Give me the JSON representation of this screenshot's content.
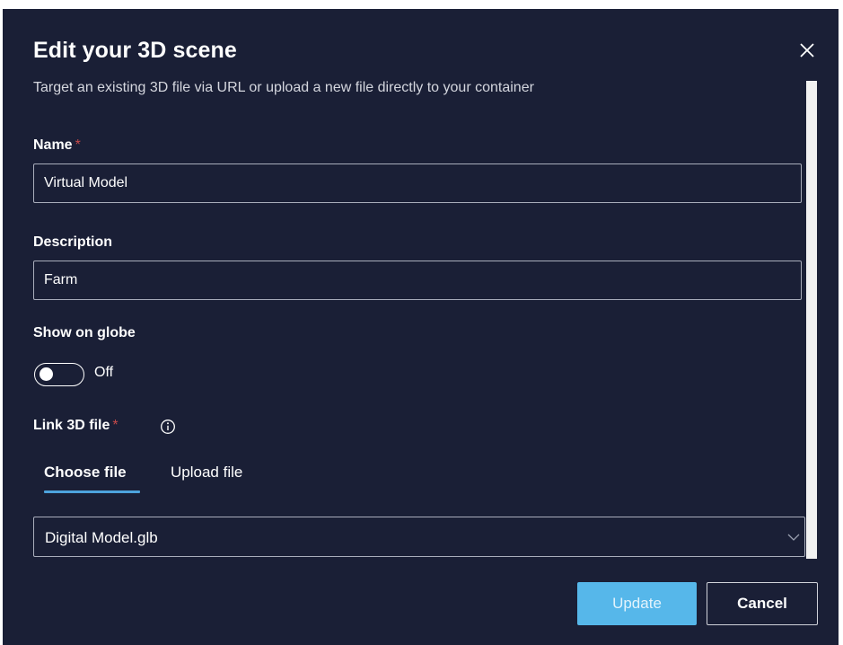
{
  "dialog": {
    "title": "Edit your 3D scene",
    "subtitle": "Target an existing 3D file via URL or upload a new file directly to your container",
    "close_icon": "close-icon"
  },
  "form": {
    "name": {
      "label": "Name",
      "required_mark": "*",
      "value": "Virtual Model"
    },
    "description": {
      "label": "Description",
      "value": "Farm"
    },
    "show_on_globe": {
      "label": "Show on globe",
      "state_text": "Off",
      "checked": false
    },
    "link_file": {
      "label": "Link 3D file",
      "required_mark": "*",
      "info_icon": "info-icon",
      "tabs": [
        {
          "label": "Choose file",
          "active": true
        },
        {
          "label": "Upload file",
          "active": false
        }
      ],
      "selected_file": "Digital Model.glb"
    }
  },
  "actions": {
    "update_label": "Update",
    "cancel_label": "Cancel"
  },
  "colors": {
    "background": "#1a1f36",
    "primary_button": "#56b7ea",
    "tab_underline": "#4da3dd",
    "required": "#c64a4a"
  }
}
